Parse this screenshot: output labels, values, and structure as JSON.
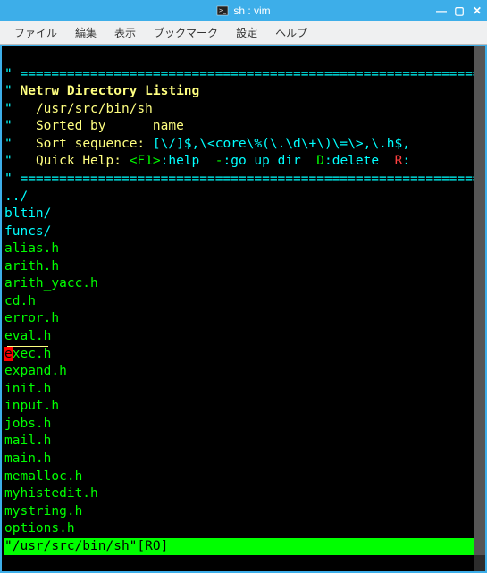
{
  "window": {
    "title": "sh : vim"
  },
  "menu": {
    "file": "ファイル",
    "edit": "編集",
    "view": "表示",
    "bookmark": "ブックマーク",
    "settings": "設定",
    "help": "ヘルプ"
  },
  "netrw": {
    "rule": "===========================================================",
    "title": "Netrw Directory Listing",
    "path": "/usr/src/bin/sh",
    "sorted_label": "Sorted by",
    "sorted_value": "name",
    "sort_seq_label": "Sort sequence:",
    "sort_seq_value": "[\\/]$,\\<core\\%(\\.\\d\\+\\)\\=\\>,\\.h$,",
    "quick_label": "Quick Help:",
    "help_key": "<F1>",
    "help_action": ":help",
    "up_key": "-",
    "up_action": ":go up dir",
    "del_key": "D",
    "del_action": ":delete",
    "ren_key": "R",
    "ren_action": ":"
  },
  "entries": {
    "parent": "../",
    "dirs": [
      "bltin/",
      "funcs/"
    ],
    "files_top": [
      "alias.h",
      "arith.h",
      "arith_yacc.h",
      "cd.h",
      "error.h",
      "eval.h"
    ],
    "cursor_first": "e",
    "cursor_rest": "xec.h",
    "files_bottom": [
      "expand.h",
      "init.h",
      "input.h",
      "jobs.h",
      "mail.h",
      "main.h",
      "memalloc.h",
      "myhistedit.h",
      "mystring.h",
      "options.h"
    ]
  },
  "status": {
    "text": "\"/usr/src/bin/sh\"[RO]                                            "
  }
}
